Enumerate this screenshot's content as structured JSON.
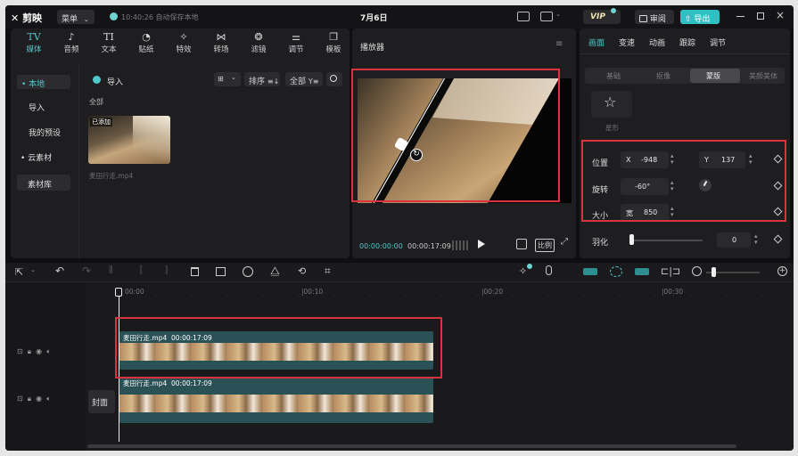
{
  "titlebar": {
    "logo": "剪映",
    "menu_label": "菜单",
    "autosave": "10:40:26 自动保存本地",
    "project_title": "7月6日",
    "vip": "VIP",
    "review_label": "审阅",
    "export_label": "导出"
  },
  "toolbar_tabs": [
    {
      "label": "媒体",
      "icon": "TV"
    },
    {
      "label": "音频",
      "icon": "♪"
    },
    {
      "label": "文本",
      "icon": "TI"
    },
    {
      "label": "贴纸",
      "icon": "◔"
    },
    {
      "label": "特效",
      "icon": "✧"
    },
    {
      "label": "转场",
      "icon": "⋈"
    },
    {
      "label": "滤镜",
      "icon": "❂"
    },
    {
      "label": "调节",
      "icon": "⚌"
    },
    {
      "label": "模板",
      "icon": "❐"
    }
  ],
  "media_sidebar": {
    "items": [
      "• 本地",
      "导入",
      "我的预设",
      "• 云素材",
      "素材库"
    ]
  },
  "media_panel": {
    "import_label": "导入",
    "sort_label": "排序",
    "all_label": "全部",
    "section_label": "全部",
    "clip_badge": "已添加",
    "clip_name": "麦田行走.mp4"
  },
  "player": {
    "title": "播放器",
    "time_current": "00:00:00:00",
    "time_total": "00:00:17:09",
    "ratio_label": "比例"
  },
  "inspector": {
    "tabs": [
      "画面",
      "变速",
      "动画",
      "跟踪",
      "调节"
    ],
    "subtabs": [
      "基础",
      "抠像",
      "蒙版",
      "美颜美体"
    ],
    "mask_shape_label": "星形",
    "position_label": "位置",
    "x_label": "X",
    "x_value": "-948",
    "y_label": "Y",
    "y_value": "137",
    "rotation_label": "旋转",
    "rotation_value": "-60°",
    "size_label": "大小",
    "width_label": "宽",
    "width_value": "850",
    "feather_label": "羽化",
    "feather_value": "0"
  },
  "timeline": {
    "ruler_labels": [
      "00:00",
      "|00:10",
      "|00:20",
      "|00:30"
    ],
    "clip1_name": "麦田行走.mp4",
    "clip1_duration": "00:00:17:09",
    "clip2_name": "麦田行走.mp4",
    "clip2_duration": "00:00:17:09",
    "cover_label": "封面"
  }
}
